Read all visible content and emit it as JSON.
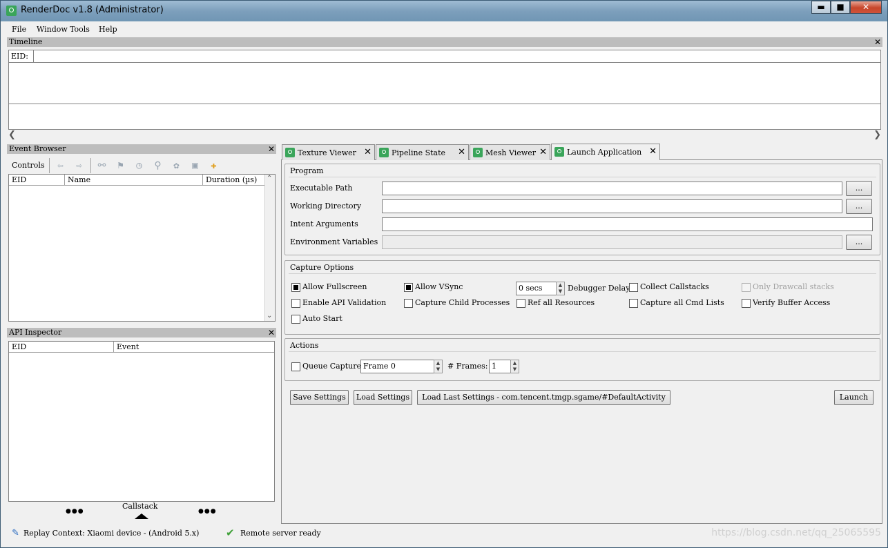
{
  "window": {
    "title": "RenderDoc v1.8 (Administrator)",
    "buttons": [
      "▬",
      "■",
      "✕"
    ]
  },
  "menu": [
    "File",
    "Window",
    "Tools",
    "Help"
  ],
  "timeline": {
    "title": "Timeline",
    "eid_label": "EID:"
  },
  "event_browser": {
    "title": "Event Browser",
    "controls_label": "Controls",
    "toolbar_icons": [
      "back-arrow-icon",
      "forward-arrow-icon",
      "binoculars-icon",
      "flag-icon",
      "clock-icon",
      "bookmark-icon",
      "settings-gear-icon",
      "save-icon",
      "puzzle-icon"
    ],
    "columns": [
      "EID",
      "Name",
      "Duration (µs)"
    ]
  },
  "api_inspector": {
    "title": "API Inspector",
    "columns": [
      "EID",
      "Event"
    ],
    "callstack_label": "Callstack",
    "dots_left": "●●●",
    "dots_right": "●●●"
  },
  "tabs": [
    {
      "label": "Texture Viewer",
      "active": false
    },
    {
      "label": "Pipeline State",
      "active": false
    },
    {
      "label": "Mesh Viewer",
      "active": false
    },
    {
      "label": "Launch Application",
      "active": true
    }
  ],
  "program": {
    "title": "Program",
    "executable_path_label": "Executable Path",
    "executable_path_value": "",
    "working_directory_label": "Working Directory",
    "working_directory_value": "",
    "intent_arguments_label": "Intent Arguments",
    "intent_arguments_value": "",
    "environment_variables_label": "Environment Variables",
    "environment_variables_value": "",
    "browse_label": "..."
  },
  "capture_options": {
    "title": "Capture Options",
    "allow_fullscreen": {
      "label": "Allow Fullscreen",
      "checked": true
    },
    "allow_vsync": {
      "label": "Allow VSync",
      "checked": true
    },
    "debugger_delay_value": "0 secs",
    "debugger_delay_label": "Debugger Delay",
    "collect_callstacks": {
      "label": "Collect Callstacks",
      "checked": false
    },
    "only_drawcall_stacks": {
      "label": "Only Drawcall stacks",
      "checked": false,
      "disabled": true
    },
    "enable_api_validation": {
      "label": "Enable API Validation",
      "checked": false
    },
    "capture_child_processes": {
      "label": "Capture Child Processes",
      "checked": false
    },
    "ref_all_resources": {
      "label": "Ref all Resources",
      "checked": false
    },
    "capture_all_cmd_lists": {
      "label": "Capture all Cmd Lists",
      "checked": false
    },
    "verify_buffer_access": {
      "label": "Verify Buffer Access",
      "checked": false
    },
    "auto_start": {
      "label": "Auto Start",
      "checked": false
    }
  },
  "actions": {
    "title": "Actions",
    "queue_capture_label": "Queue Capture",
    "frame_value": "Frame 0",
    "frames_label": "# Frames:",
    "frames_value": "1"
  },
  "buttons": {
    "save_settings": "Save Settings",
    "load_settings": "Load Settings",
    "load_last_settings": "Load Last Settings - com.tencent.tmgp.sgame/#DefaultActivity",
    "launch": "Launch"
  },
  "status": {
    "replay_context": "Replay Context: Xiaomi device - (Android 5.x)",
    "remote_server": "Remote server ready",
    "watermark": "https://blog.csdn.net/qq_25065595"
  }
}
